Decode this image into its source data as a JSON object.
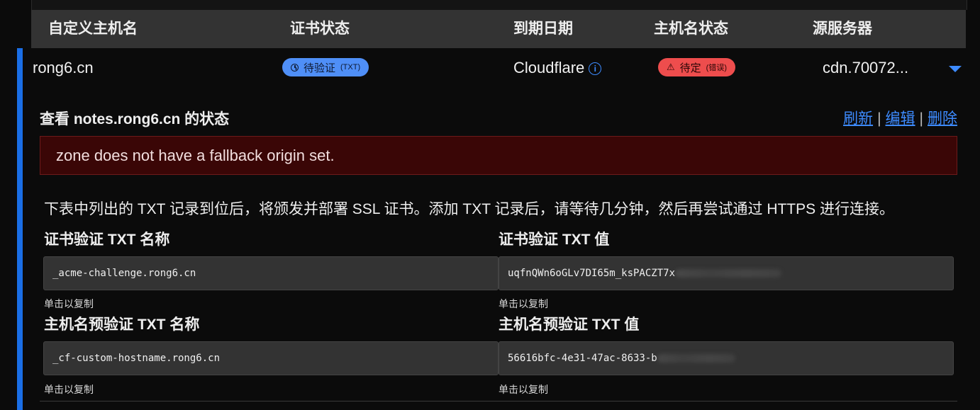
{
  "table": {
    "headers": [
      "自定义主机名",
      "证书状态",
      "到期日期",
      "主机名状态",
      "源服务器"
    ]
  },
  "row": {
    "hostname": "rong6.cn",
    "cert_status": {
      "label": "待验证",
      "sub": "(TXT)",
      "icon": "clock-icon",
      "color": "#4f8ff7"
    },
    "expiry": "Cloudflare",
    "expiry_info_icon": "ⓘ",
    "hostname_status": {
      "label": "待定",
      "sub": "(错误)",
      "icon": "warning-icon",
      "glyph": "⚠",
      "color": "#ee4d4d"
    },
    "origin": "cdn.70072..."
  },
  "details": {
    "title": "查看 notes.rong6.cn 的状态",
    "actions": {
      "refresh": "刷新",
      "edit": "编辑",
      "delete": "删除",
      "separator": "|"
    },
    "error": "zone does not have a fallback origin set.",
    "description": "下表中列出的 TXT 记录到位后，将颁发并部署 SSL 证书。添加 TXT 记录后，请等待几分钟，然后再尝试通过 HTTPS 进行连接。",
    "cert_txt_name_label": "证书验证 TXT 名称",
    "cert_txt_name_value": "_acme-challenge.rong6.cn",
    "cert_txt_value_label": "证书验证 TXT 值",
    "cert_txt_value_value": "uqfnQWn6oGLv7DI65m_ksPACZT7x",
    "pre_txt_name_label": "主机名预验证 TXT 名称",
    "pre_txt_name_value": "_cf-custom-hostname.rong6.cn",
    "pre_txt_value_label": "主机名预验证 TXT 值",
    "pre_txt_value_value": "56616bfc-4e31-47ac-8633-b",
    "copy_hint": "单击以复制"
  },
  "colors": {
    "accent": "#1a6ee6",
    "link": "#3d8bff",
    "error_bg": "#3a0606"
  }
}
